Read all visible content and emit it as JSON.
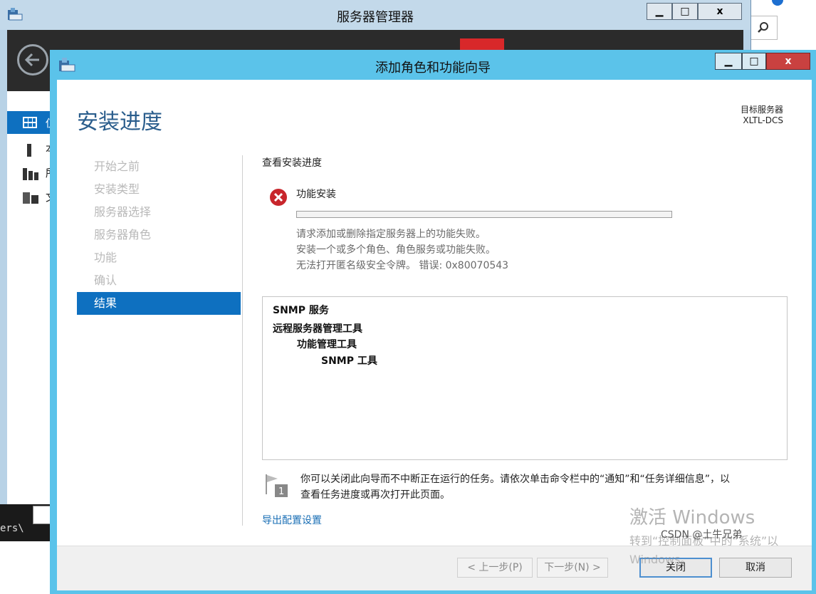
{
  "server_manager": {
    "title": "服务器管理器",
    "nav_items": [
      {
        "label": "仪"
      },
      {
        "label": "本"
      },
      {
        "label": "所"
      },
      {
        "label": "文"
      }
    ],
    "bottom_text": "ers\\",
    "window_controls": {
      "minimize": "▁",
      "maximize": "□",
      "close": "x"
    }
  },
  "wizard": {
    "title": "添加角色和功能向导",
    "heading": "安装进度",
    "target_server": {
      "label": "目标服务器",
      "value": "XLTL-DCS"
    },
    "window_controls": {
      "minimize": "▁",
      "maximize": "□",
      "close": "x"
    },
    "steps": [
      {
        "label": "开始之前",
        "selected": false
      },
      {
        "label": "安装类型",
        "selected": false
      },
      {
        "label": "服务器选择",
        "selected": false
      },
      {
        "label": "服务器角色",
        "selected": false
      },
      {
        "label": "功能",
        "selected": false
      },
      {
        "label": "确认",
        "selected": false
      },
      {
        "label": "结果",
        "selected": true
      }
    ],
    "content": {
      "title": "查看安装进度",
      "status_icon": "error-icon",
      "feature_label": "功能安装",
      "progress_fraction": 0,
      "messages": [
        "请求添加或删除指定服务器上的功能失败。",
        "安装一个或多个角色、角色服务或功能失败。",
        "无法打开匿名级安全令牌。 错误: 0x80070543"
      ],
      "results": [
        {
          "label": "SNMP 服务",
          "level": 0
        },
        {
          "label": "远程服务器管理工具",
          "level": 0
        },
        {
          "label": "功能管理工具",
          "level": 1
        },
        {
          "label": "SNMP 工具",
          "level": 2
        }
      ],
      "note_lines": [
        "你可以关闭此向导而不中断正在运行的任务。请依次单击命令栏中的“通知”和“任务详细信息”，以",
        "查看任务进度或再次打开此页面。"
      ],
      "export_link": "导出配置设置"
    },
    "buttons": {
      "prev": "< 上一步(P)",
      "next": "下一步(N) >",
      "close": "关闭",
      "cancel": "取消"
    },
    "activation": {
      "line1": "激活 Windows",
      "line2": "转到“控制面板”中的“系统”以",
      "line3": "Windows。"
    }
  },
  "watermark": "CSDN @土牛兄弟",
  "colors": {
    "accent": "#0e70c0",
    "heading": "#2a5d8c",
    "wizard_frame": "#5bc3ea",
    "error": "#c8262c",
    "link": "#1a6fb5"
  }
}
